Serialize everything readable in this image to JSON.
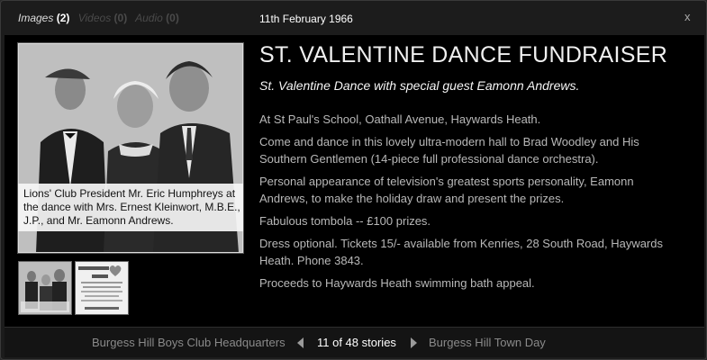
{
  "tabs": [
    {
      "label": "Images",
      "count": "(2)"
    },
    {
      "label": "Videos",
      "count": "(0)"
    },
    {
      "label": "Audio",
      "count": "(0)"
    }
  ],
  "date": "11th February 1966",
  "close_label": "x",
  "photo": {
    "caption": "Lions' Club President Mr. Eric Humphreys at the dance with Mrs. Ernest Kleinwort, M.B.E., J.P., and Mr. Eamonn Andrews."
  },
  "thumbnails": [
    "photo-thumbnail",
    "poster-thumbnail"
  ],
  "article": {
    "headline": "ST. VALENTINE DANCE FUNDRAISER",
    "subheadline": "St. Valentine Dance with special guest Eamonn Andrews.",
    "paragraphs": [
      "At St Paul's School, Oathall Avenue, Haywards Heath.",
      "Come and dance in this lovely ultra-modern hall to Brad Woodley and His Southern Gentlemen (14-piece full professional dance orchestra).",
      "Personal appearance of television's greatest sports personality, Eamonn Andrews, to make the holiday draw and present the prizes.",
      "Fabulous tombola -- £100 prizes.",
      "Dress optional. Tickets 15/- available from Kenries, 28 South Road, Haywards Heath. Phone 3843.",
      "Proceeds to Haywards Heath swimming bath appeal."
    ]
  },
  "footer": {
    "prev": "Burgess Hill Boys Club Headquarters",
    "counter": "11 of 48 stories",
    "next": "Burgess Hill Town Day"
  },
  "colors": {
    "background": "#000000",
    "frame": "#1c1c1c",
    "footer": "#141414"
  },
  "icons": [
    "close-icon",
    "arrow-left-icon",
    "arrow-right-icon",
    "heart-icon"
  ]
}
